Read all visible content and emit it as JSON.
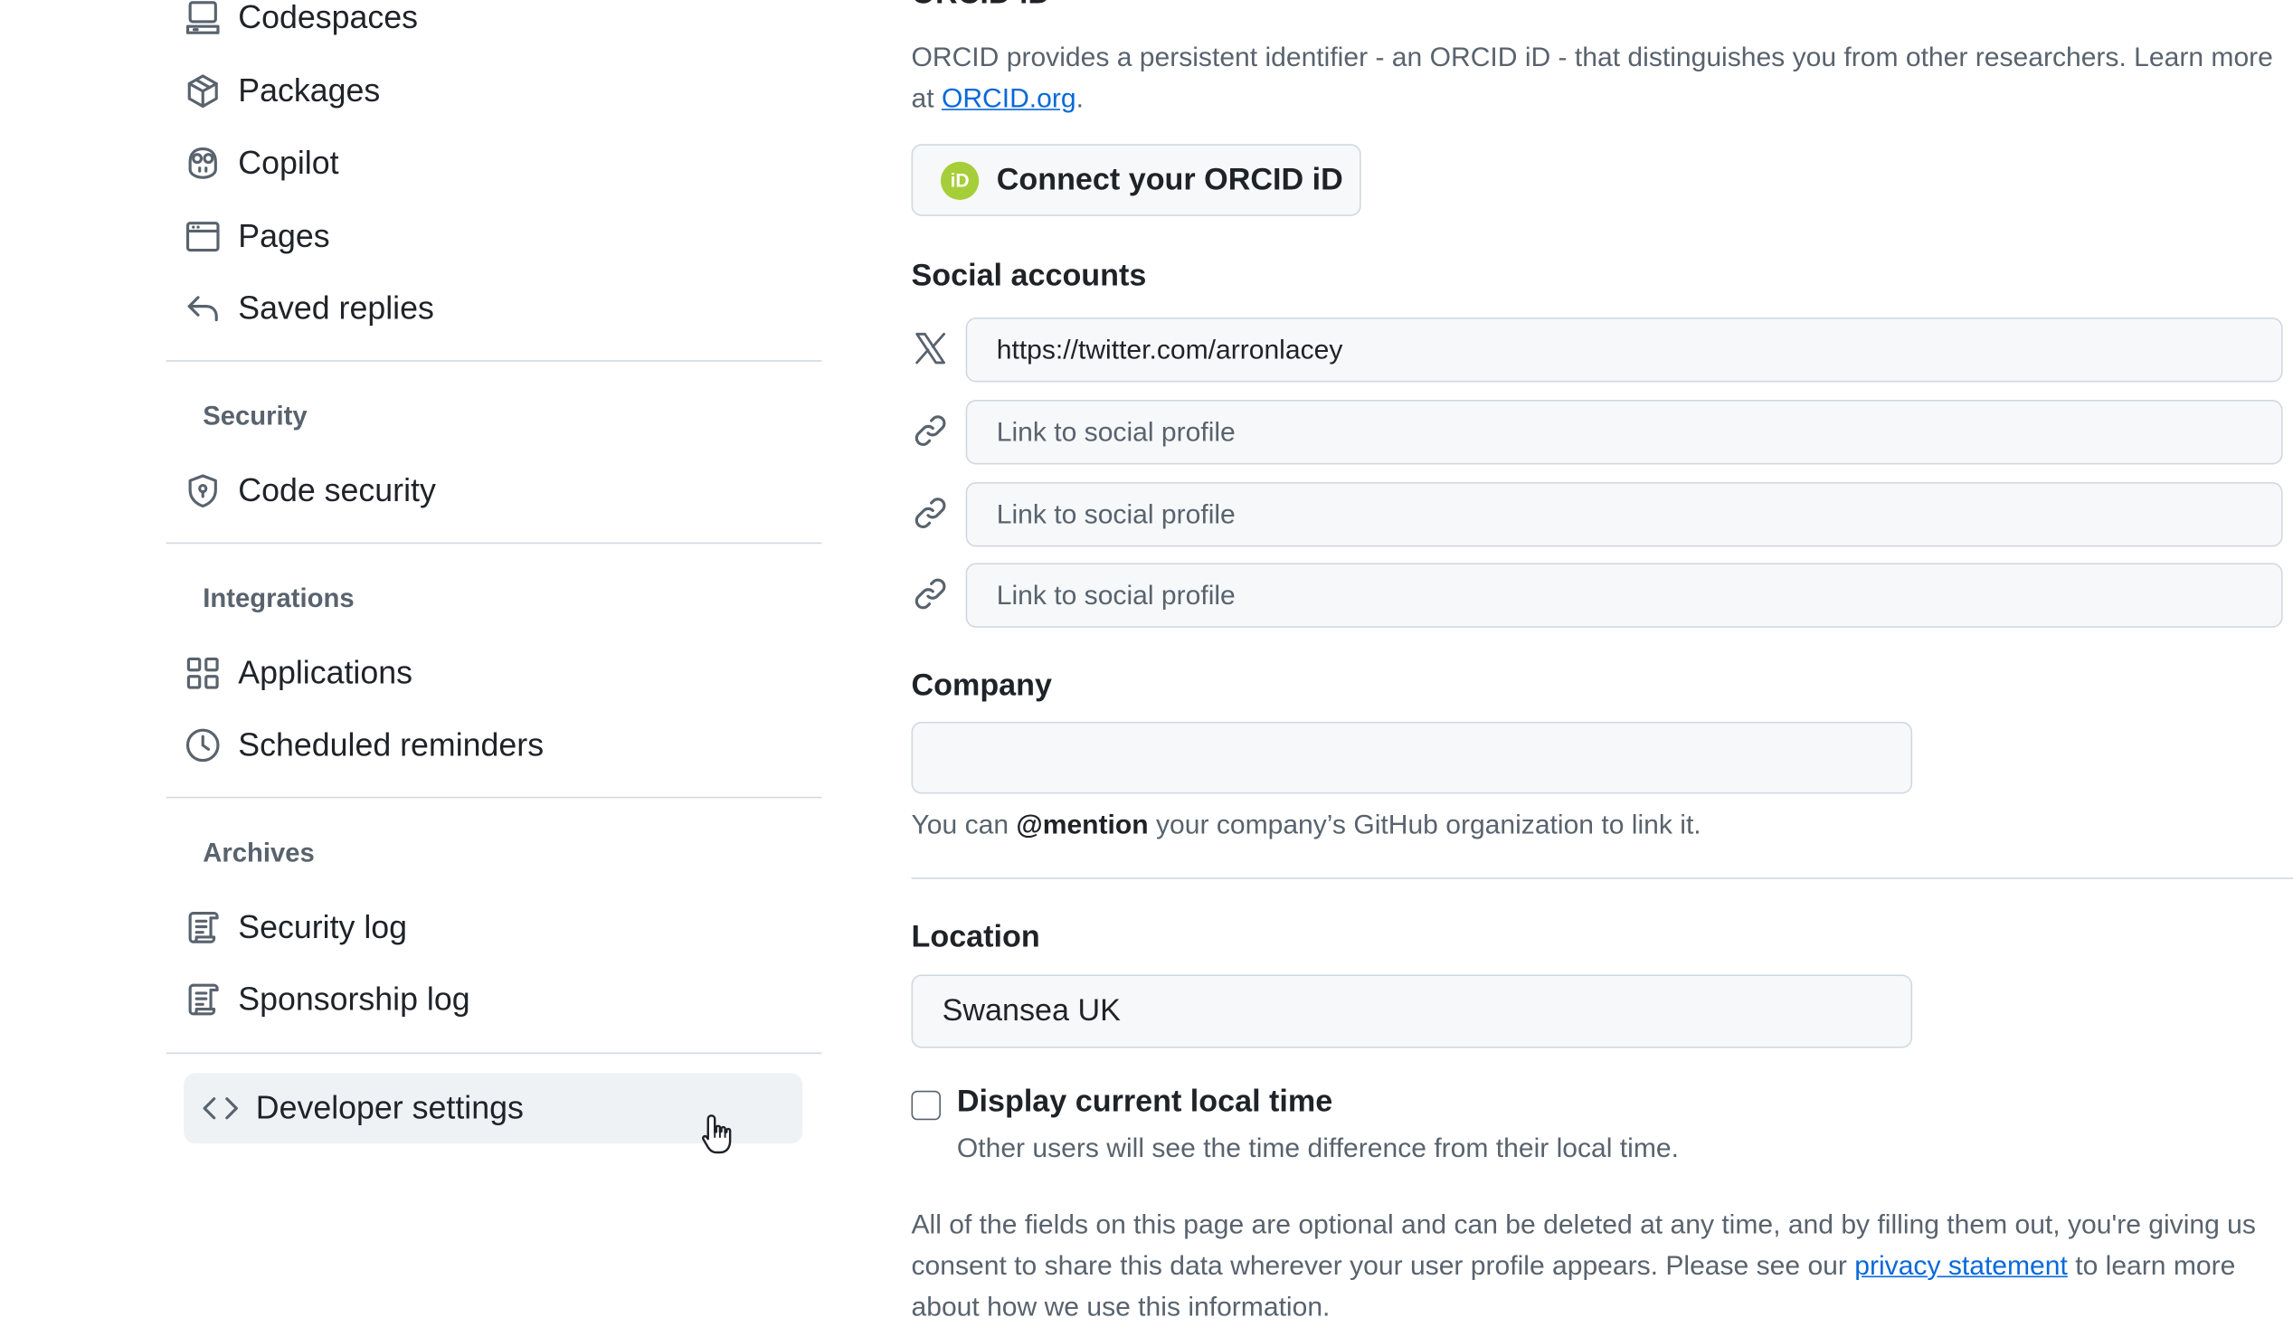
{
  "sidebar": {
    "items_top": [
      {
        "label": "Codespaces",
        "icon": "codespaces-icon"
      },
      {
        "label": "Packages",
        "icon": "package-icon"
      },
      {
        "label": "Copilot",
        "icon": "copilot-icon"
      },
      {
        "label": "Pages",
        "icon": "browser-icon"
      },
      {
        "label": "Saved replies",
        "icon": "reply-icon"
      }
    ],
    "security": {
      "title": "Security",
      "items": [
        {
          "label": "Code security",
          "icon": "shield-lock-icon"
        }
      ]
    },
    "integrations": {
      "title": "Integrations",
      "items": [
        {
          "label": "Applications",
          "icon": "apps-icon"
        },
        {
          "label": "Scheduled reminders",
          "icon": "clock-icon"
        }
      ]
    },
    "archives": {
      "title": "Archives",
      "items": [
        {
          "label": "Security log",
          "icon": "log-icon"
        },
        {
          "label": "Sponsorship log",
          "icon": "log-icon"
        }
      ]
    },
    "developer": {
      "label": "Developer settings",
      "icon": "code-icon"
    }
  },
  "orcid": {
    "title": "ORCID iD",
    "description": "ORCID provides a persistent identifier - an ORCID iD - that distinguishes you from other researchers. Learn more at",
    "link_text": "ORCID.org",
    "after_link": ".",
    "button_label": "Connect your ORCID iD",
    "logo_text": "iD"
  },
  "social": {
    "title": "Social accounts",
    "accounts": [
      {
        "icon": "x-twitter-icon",
        "value": "https://twitter.com/arronlacey",
        "placeholder": "Link to social profile"
      },
      {
        "icon": "link-icon",
        "value": "",
        "placeholder": "Link to social profile"
      },
      {
        "icon": "link-icon",
        "value": "",
        "placeholder": "Link to social profile"
      },
      {
        "icon": "link-icon",
        "value": "",
        "placeholder": "Link to social profile"
      }
    ]
  },
  "company": {
    "title": "Company",
    "value": "",
    "help_prefix": "You can ",
    "help_bold": "@mention",
    "help_suffix": " your company’s GitHub organization to link it."
  },
  "location": {
    "title": "Location",
    "value": "Swansea UK"
  },
  "local_time": {
    "label": "Display current local time",
    "help": "Other users will see the time difference from their local time.",
    "checked": false
  },
  "footer": {
    "text_before": "All of the fields on this page are optional and can be deleted at any time, and by filling them out, you're giving us consent to share this data wherever your user profile appears. Please see our ",
    "link_text": "privacy statement",
    "text_after": " to learn more about how we use this information."
  },
  "colors": {
    "accent_link": "#0969da",
    "orcid_green": "#a6ce39",
    "muted_text": "#59636e"
  }
}
